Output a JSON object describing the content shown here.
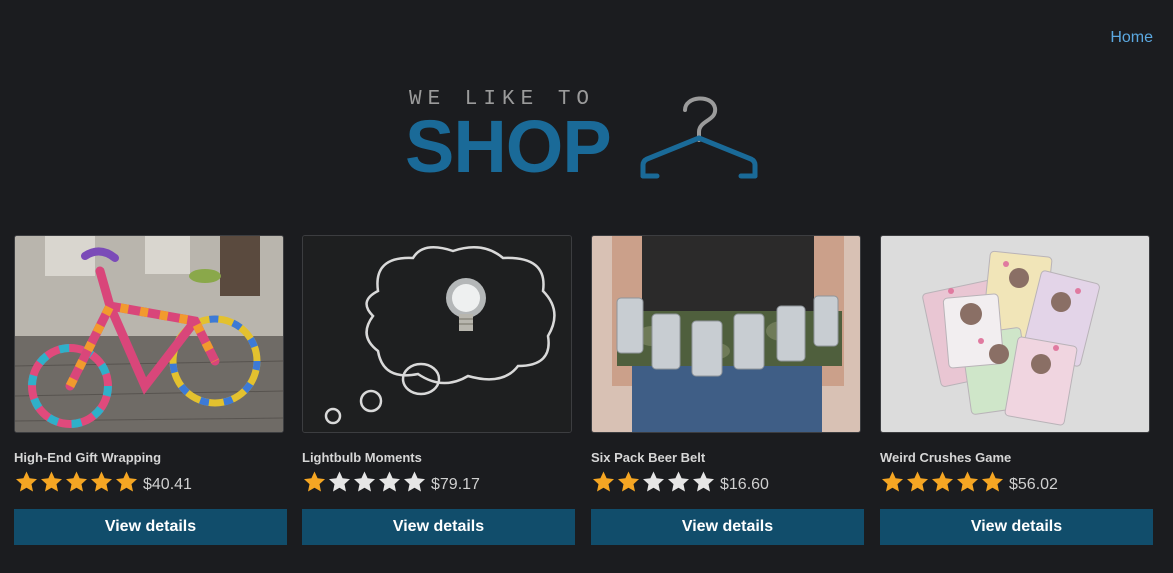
{
  "nav": {
    "home_label": "Home"
  },
  "logo": {
    "tagline": "WE LIKE TO",
    "wordmark": "SHOP"
  },
  "colors": {
    "background": "#1b1c1f",
    "accent": "#1a6a98",
    "button": "#114d6b",
    "link": "#5ba8e0",
    "star_filled": "#f5a623",
    "star_empty": "#e6e6e6"
  },
  "products": [
    {
      "name": "High-End Gift Wrapping",
      "rating": 5,
      "price": "$40.41",
      "button_label": "View details",
      "image": "yarn-bombed-bicycle-photo"
    },
    {
      "name": "Lightbulb Moments",
      "rating": 1,
      "price": "$79.17",
      "button_label": "View details",
      "image": "lightbulb-chalk-cloud-photo"
    },
    {
      "name": "Six Pack Beer Belt",
      "rating": 2,
      "price": "$16.60",
      "button_label": "View details",
      "image": "beer-can-belt-photo"
    },
    {
      "name": "Weird Crushes Game",
      "rating": 5,
      "price": "$56.02",
      "button_label": "View details",
      "image": "trading-cards-photo"
    }
  ]
}
